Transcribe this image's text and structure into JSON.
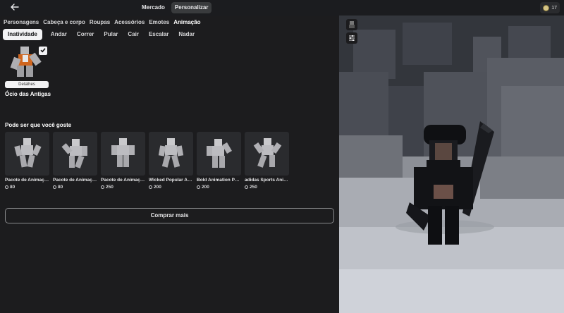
{
  "topbar": {
    "back_icon": "arrow-left-icon",
    "tabs": [
      {
        "label": "Mercado",
        "active": false
      },
      {
        "label": "Personalizar",
        "active": true
      }
    ],
    "robux_count": "17"
  },
  "categories": [
    {
      "label": "Personagens",
      "active": false
    },
    {
      "label": "Cabeça e corpo",
      "active": false
    },
    {
      "label": "Roupas",
      "active": false
    },
    {
      "label": "Acessórios",
      "active": false
    },
    {
      "label": "Emotes",
      "active": false
    },
    {
      "label": "Animação",
      "active": true
    }
  ],
  "subcategories": [
    {
      "label": "Inatividade",
      "active": true
    },
    {
      "label": "Andar",
      "active": false
    },
    {
      "label": "Correr",
      "active": false
    },
    {
      "label": "Pular",
      "active": false
    },
    {
      "label": "Cair",
      "active": false
    },
    {
      "label": "Escalar",
      "active": false
    },
    {
      "label": "Nadar",
      "active": false
    }
  ],
  "owned_item": {
    "name": "Ócio das Antigas",
    "details_label": "Detalhes",
    "equipped": true
  },
  "recommendations": {
    "title": "Pode ser que você goste",
    "items": [
      {
        "name": "Pacote de Animação...",
        "price": "80"
      },
      {
        "name": "Pacote de Animação...",
        "price": "80"
      },
      {
        "name": "Pacote de Animação...",
        "price": "250"
      },
      {
        "name": "Wicked Popular Ani...",
        "price": "200"
      },
      {
        "name": "Bold Animation Pac...",
        "price": "200"
      },
      {
        "name": "adidas Sports Anim...",
        "price": "250"
      }
    ],
    "buy_more_label": "Comprar mais"
  },
  "colors": {
    "panel_bg": "#1c1c1e",
    "topbar_bg": "#1b1c1f",
    "active_tab_bg": "#393b3d",
    "active_sub_bg": "#f2f2f4",
    "card_bg": "#2a2b2e"
  }
}
